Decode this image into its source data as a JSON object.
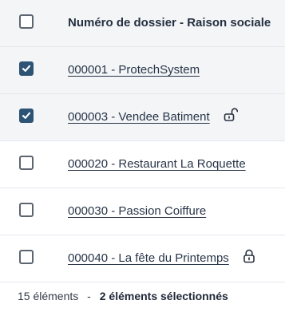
{
  "table": {
    "header": {
      "select_all_checked": false,
      "title": "Numéro de dossier - Raison sociale"
    },
    "rows": [
      {
        "label": "000001 - ProtechSystem",
        "checked": true,
        "selected": true,
        "lock_icon": ""
      },
      {
        "label": "000003 - Vendee Batiment",
        "checked": true,
        "selected": true,
        "lock_icon": "unlocked-padlock-icon"
      },
      {
        "label": "000020 - Restaurant La Roquette",
        "checked": false,
        "selected": false,
        "lock_icon": ""
      },
      {
        "label": "000030 - Passion Coiffure",
        "checked": false,
        "selected": false,
        "lock_icon": ""
      },
      {
        "label": "000040 - La fête du Printemps",
        "checked": false,
        "selected": false,
        "lock_icon": "locked-padlock-icon"
      }
    ]
  },
  "footer": {
    "count_text": "15 éléments",
    "separator": "-",
    "selected_text": "2 éléments sélectionnés"
  },
  "colors": {
    "checked_box": "#2e5475",
    "selected_row_background": "#f3f5f7",
    "header_background": "#f3f5f7"
  }
}
